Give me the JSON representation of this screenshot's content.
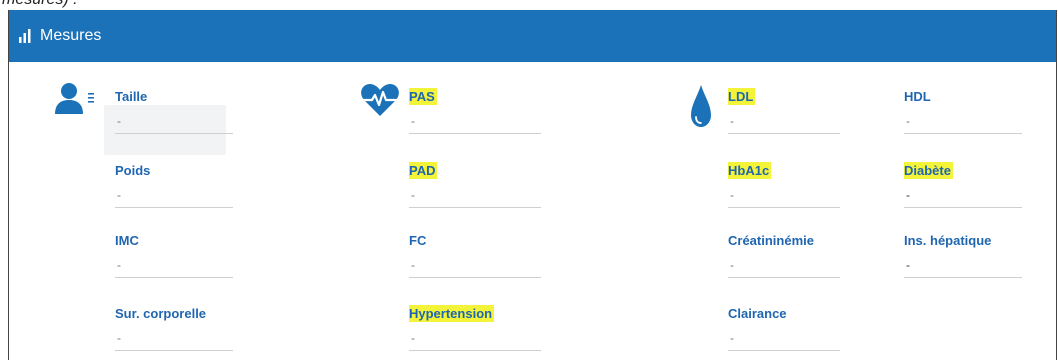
{
  "caption": "mesures) :",
  "header": {
    "title": "Mesures",
    "icon": "bar-chart-icon"
  },
  "colors": {
    "header_bg": "#1b72b8",
    "label": "#1f66b0",
    "highlight": "#f3f33a"
  },
  "groups": {
    "anthropometry": {
      "icon": "person-list-icon",
      "fields": [
        {
          "label": "Taille",
          "value": "-"
        },
        {
          "label": "Poids",
          "value": "-"
        },
        {
          "label": "IMC",
          "value": "-"
        },
        {
          "label": "Sur. corporelle",
          "value": "-"
        }
      ]
    },
    "cardio": {
      "icon": "heart-pulse-icon",
      "fields": [
        {
          "label": "PAS",
          "value": "-"
        },
        {
          "label": "PAD",
          "value": "-"
        },
        {
          "label": "FC",
          "value": "-"
        },
        {
          "label": "Hypertension",
          "value": "-"
        }
      ]
    },
    "biology": {
      "icon": "blood-drop-icon",
      "fields": [
        {
          "label": "LDL",
          "value": "-"
        },
        {
          "label": "HbA1c",
          "value": "-"
        },
        {
          "label": "Créatininémie",
          "value": "-"
        },
        {
          "label": "Clairance",
          "value": "-"
        }
      ]
    },
    "biology_extra": {
      "fields": [
        {
          "label": "HDL",
          "value": "-"
        },
        {
          "label": "Diabète",
          "value": "-"
        },
        {
          "label": "Ins. hépatique",
          "value": "-"
        }
      ]
    }
  }
}
